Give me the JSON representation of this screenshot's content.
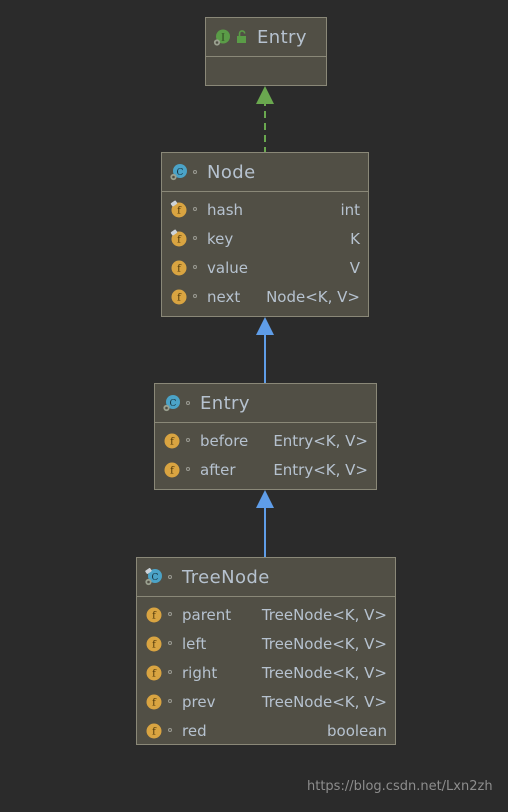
{
  "diagram": {
    "title": "UML class hierarchy diagram",
    "background_color": "#2b2b2b",
    "box_fill_color": "#514f45",
    "box_border_color": "#8a8878",
    "text_color": "#b6c2cf",
    "interface_icon_color": "#5a9c47",
    "class_icon_color": "#4ba3c7",
    "field_icon_color": "#d9a441",
    "realization_arrow_color": "#6aa84f",
    "inheritance_arrow_color": "#5f9de8"
  },
  "classes": [
    {
      "id": "entry-interface",
      "name": "Entry",
      "icon": "interface-icon",
      "secondary_icon": "lock-icon",
      "visibility_icon": null,
      "fields": []
    },
    {
      "id": "node-class",
      "name": "Node",
      "icon": "class-icon",
      "visibility_icon": "visibility-dot-icon",
      "fields": [
        {
          "icon": "field-icon",
          "final": true,
          "visibility_icon": "visibility-dot-icon",
          "name": "hash",
          "type": "int"
        },
        {
          "icon": "field-icon",
          "final": true,
          "visibility_icon": "visibility-dot-icon",
          "name": "key",
          "type": "K"
        },
        {
          "icon": "field-icon",
          "final": false,
          "visibility_icon": "visibility-dot-icon",
          "name": "value",
          "type": "V"
        },
        {
          "icon": "field-icon",
          "final": false,
          "visibility_icon": "visibility-dot-icon",
          "name": "next",
          "type": "Node<K, V>"
        }
      ]
    },
    {
      "id": "entry-class",
      "name": "Entry",
      "icon": "class-icon",
      "visibility_icon": "visibility-dot-icon",
      "fields": [
        {
          "icon": "field-icon",
          "final": false,
          "visibility_icon": "visibility-dot-icon",
          "name": "before",
          "type": "Entry<K, V>"
        },
        {
          "icon": "field-icon",
          "final": false,
          "visibility_icon": "visibility-dot-icon",
          "name": "after",
          "type": "Entry<K, V>"
        }
      ]
    },
    {
      "id": "treenode-class",
      "name": "TreeNode",
      "icon": "class-icon",
      "visibility_icon": "visibility-dot-icon",
      "fields": [
        {
          "icon": "field-icon",
          "final": false,
          "visibility_icon": "visibility-dot-icon",
          "name": "parent",
          "type": "TreeNode<K, V>"
        },
        {
          "icon": "field-icon",
          "final": false,
          "visibility_icon": "visibility-dot-icon",
          "name": "left",
          "type": "TreeNode<K, V>"
        },
        {
          "icon": "field-icon",
          "final": false,
          "visibility_icon": "visibility-dot-icon",
          "name": "right",
          "type": "TreeNode<K, V>"
        },
        {
          "icon": "field-icon",
          "final": false,
          "visibility_icon": "visibility-dot-icon",
          "name": "prev",
          "type": "TreeNode<K, V>"
        },
        {
          "icon": "field-icon",
          "final": false,
          "visibility_icon": "visibility-dot-icon",
          "name": "red",
          "type": "boolean"
        }
      ]
    }
  ],
  "connections": [
    {
      "id": "node-implements-entry",
      "from": "node-class",
      "to": "entry-interface",
      "kind": "realization",
      "style": "dashed",
      "color": "#6aa84f"
    },
    {
      "id": "entry-extends-node",
      "from": "entry-class",
      "to": "node-class",
      "kind": "inheritance",
      "style": "solid",
      "color": "#5f9de8"
    },
    {
      "id": "treenode-extends-entry",
      "from": "treenode-class",
      "to": "entry-class",
      "kind": "inheritance",
      "style": "solid",
      "color": "#5f9de8"
    }
  ],
  "watermark": {
    "text": "https://blog.csdn.net/Lxn2zh"
  }
}
